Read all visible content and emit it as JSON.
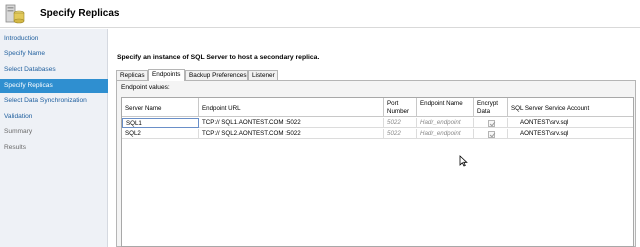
{
  "header": {
    "title": "Specify Replicas",
    "icon": "database-server-icon"
  },
  "nav": {
    "items": [
      {
        "label": "Introduction",
        "state": "link"
      },
      {
        "label": "Specify Name",
        "state": "link"
      },
      {
        "label": "Select Databases",
        "state": "link"
      },
      {
        "label": "Specify Replicas",
        "state": "active"
      },
      {
        "label": "Select Data Synchronization",
        "state": "link"
      },
      {
        "label": "Validation",
        "state": "link"
      },
      {
        "label": "Summary",
        "state": "disabled"
      },
      {
        "label": "Results",
        "state": "disabled"
      }
    ]
  },
  "main": {
    "instruction": "Specify an instance of SQL Server to host a secondary replica.",
    "tabs": [
      {
        "label": "Replicas",
        "active": false
      },
      {
        "label": "Endpoints",
        "active": true
      },
      {
        "label": "Backup Preferences",
        "active": false
      },
      {
        "label": "Listener",
        "active": false
      }
    ],
    "panel_label": "Endpoint values:",
    "grid": {
      "columns": [
        "Server Name",
        "Endpoint URL",
        "Port Number",
        "Endpoint Name",
        "Encrypt Data",
        "SQL Server Service Account"
      ],
      "rows": [
        {
          "server": "SQL1",
          "url": "TCP:// SQL1.AONTEST.COM :5022",
          "port": "5022",
          "endpoint": "Hadr_endpoint",
          "encrypt": true,
          "account": "AONTEST\\srv.sql"
        },
        {
          "server": "SQL2",
          "url": "TCP:// SQL2.AONTEST.COM :5022",
          "port": "5022",
          "endpoint": "Hadr_endpoint",
          "encrypt": true,
          "account": "AONTEST\\srv.sql"
        }
      ]
    }
  },
  "colors": {
    "accent": "#2f8fd0",
    "nav_link": "#1f5f9e",
    "nav_bg": "#eef1f6"
  }
}
